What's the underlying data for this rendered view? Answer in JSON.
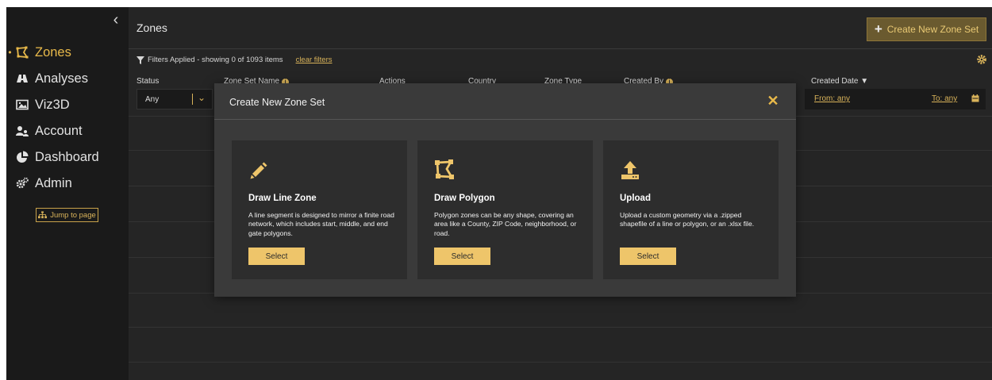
{
  "sidebar": {
    "collapse_glyph": "‹",
    "items": [
      {
        "label": "Zones",
        "icon": "zone-polygon-icon",
        "active": true
      },
      {
        "label": "Analyses",
        "icon": "binoculars-icon",
        "active": false
      },
      {
        "label": "Viz3D",
        "icon": "image-icon",
        "active": false
      },
      {
        "label": "Account",
        "icon": "users-icon",
        "active": false
      },
      {
        "label": "Dashboard",
        "icon": "pie-chart-icon",
        "active": false
      },
      {
        "label": "Admin",
        "icon": "gears-icon",
        "active": false
      }
    ],
    "jump_label": "Jump to page"
  },
  "header": {
    "title": "Zones",
    "create_button_label": "Create New Zone Set"
  },
  "filters": {
    "summary": "Filters Applied - showing 0 of 1093 items",
    "clear_label": "clear filters"
  },
  "table": {
    "columns": [
      "Status",
      "Zone Set Name",
      "Actions",
      "Country",
      "Zone Type",
      "Created By",
      "Created Date ▼"
    ],
    "status_value": "Any",
    "date_from": "From: any",
    "date_to": "To: any"
  },
  "modal": {
    "title": "Create New Zone Set",
    "close_glyph": "✕",
    "options": [
      {
        "title": "Draw Line Zone",
        "icon": "pencil-icon",
        "description": "A line segment is designed to mirror a finite road network, which includes start, middle, and end gate polygons.",
        "button": "Select"
      },
      {
        "title": "Draw Polygon",
        "icon": "polygon-icon",
        "description": "Polygon zones can be any shape, covering an area like a County, ZIP Code, neighborhood, or road.",
        "button": "Select"
      },
      {
        "title": "Upload",
        "icon": "upload-icon",
        "description": "Upload a custom geometry via a .zipped shapefile of a line or polygon, or an .xlsx file.",
        "button": "Select"
      }
    ]
  },
  "colors": {
    "accent": "#e8b94a",
    "button_fill": "#eec56a",
    "background": "#252525",
    "sidebar": "#1a1a1a",
    "modal": "#3a3a3a",
    "card": "#2d2d2d"
  }
}
